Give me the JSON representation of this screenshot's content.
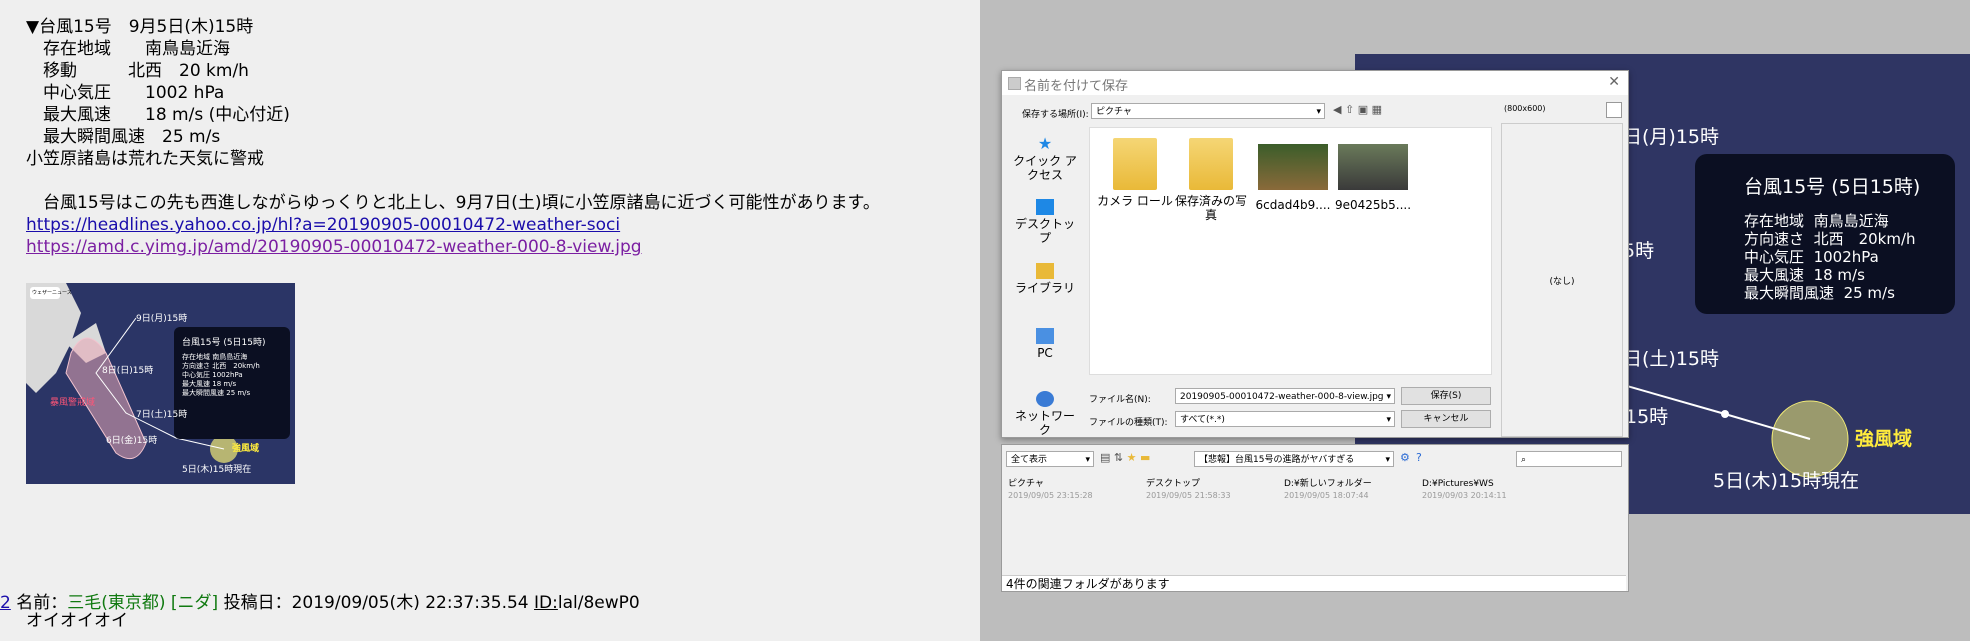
{
  "forum": {
    "lines": [
      "▼台風15号　9月5日(木)15時",
      "　存在地域　　南鳥島近海",
      "　移動　　　北西　20 km/h",
      "　中心気圧　　1002 hPa",
      "　最大風速　　18 m/s (中心付近)",
      "　最大瞬間風速　25 m/s",
      "小笠原諸島は荒れた天気に警戒",
      "　台風15号はこの先も西進しながらゆっくりと北上し、9月7日(土)頃に小笠原諸島に近づく可能性があります。"
    ],
    "link1": "https://headlines.yahoo.co.jp/hl?a=20190905-00010472-weather-soci",
    "link2": "https://amd.c.yimg.jp/amd/20190905-00010472-weather-000-8-view.jpg",
    "footer": {
      "num": "2",
      "name_label": "名前：",
      "name": "三毛(東京都) [ニダ]",
      "date": "投稿日：2019/09/05(木) 22:37:35.54",
      "id_label": "ID:",
      "id": "lal/8ewP0",
      "body": "オイオイオイ"
    }
  },
  "thumb": {
    "box_title": "台風15号 (5日15時)",
    "rows": [
      [
        "存在地域",
        "南鳥島近海"
      ],
      [
        "方向速さ",
        "北西　20km/h"
      ],
      [
        "中心気圧",
        "1002hPa"
      ],
      [
        "最大風速",
        "18 m/s"
      ],
      [
        "最大瞬間風速",
        "25 m/s"
      ]
    ],
    "labels": [
      "9日(月)15時",
      "8日(日)15時",
      "7日(土)15時",
      "6日(金)15時",
      "暴風警戒域",
      "強風域",
      "5日(木)15時現在"
    ],
    "logo": "ウェザーニュース"
  },
  "bgmap": {
    "box_title": "台風15号 (5日15時)",
    "rows": [
      [
        "存在地域",
        "南鳥島近海"
      ],
      [
        "方向速さ",
        "北西　20km/h"
      ],
      [
        "中心気圧",
        "1002hPa"
      ],
      [
        "最大風速",
        "18 m/s"
      ],
      [
        "最大瞬間風速",
        "25 m/s"
      ]
    ],
    "labels": [
      "日(月)15時",
      "5時",
      "日(土)15時",
      "15時",
      "強風域",
      "5日(木)15時現在"
    ]
  },
  "dialog": {
    "title": "名前を付けて保存",
    "save_in_label": "保存する場所(I):",
    "save_in_value": "ピクチャ",
    "preview_size": "(800x600)",
    "preview_none": "(なし)",
    "nav": [
      "クイック アクセス",
      "デスクトップ",
      "ライブラリ",
      "PC",
      "ネットワーク"
    ],
    "files": [
      "カメラ ロール",
      "保存済みの写真",
      "6cdad4b9....",
      "9e0425b5...."
    ],
    "filename_label": "ファイル名(N):",
    "filename_value": "20190905-00010472-weather-000-8-view.jpg",
    "filetype_label": "ファイルの種類(T):",
    "filetype_value": "すべて(*.*)",
    "save_button": "保存(S)",
    "cancel_button": "キャンセル"
  },
  "lower": {
    "view_select": "全て表示",
    "path_select": "【悲報】台風15号の進路がヤバすぎる",
    "recent": [
      {
        "name": "ピクチャ",
        "date": "2019/09/05 23:15:28"
      },
      {
        "name": "デスクトップ",
        "date": "2019/09/05 21:58:33"
      },
      {
        "name": "D:¥新しいフォルダー",
        "date": "2019/09/05 18:07:44"
      },
      {
        "name": "D:¥Pictures¥WS",
        "date": "2019/09/03 20:14:11"
      }
    ],
    "status": "4件の関連フォルダがあります"
  }
}
